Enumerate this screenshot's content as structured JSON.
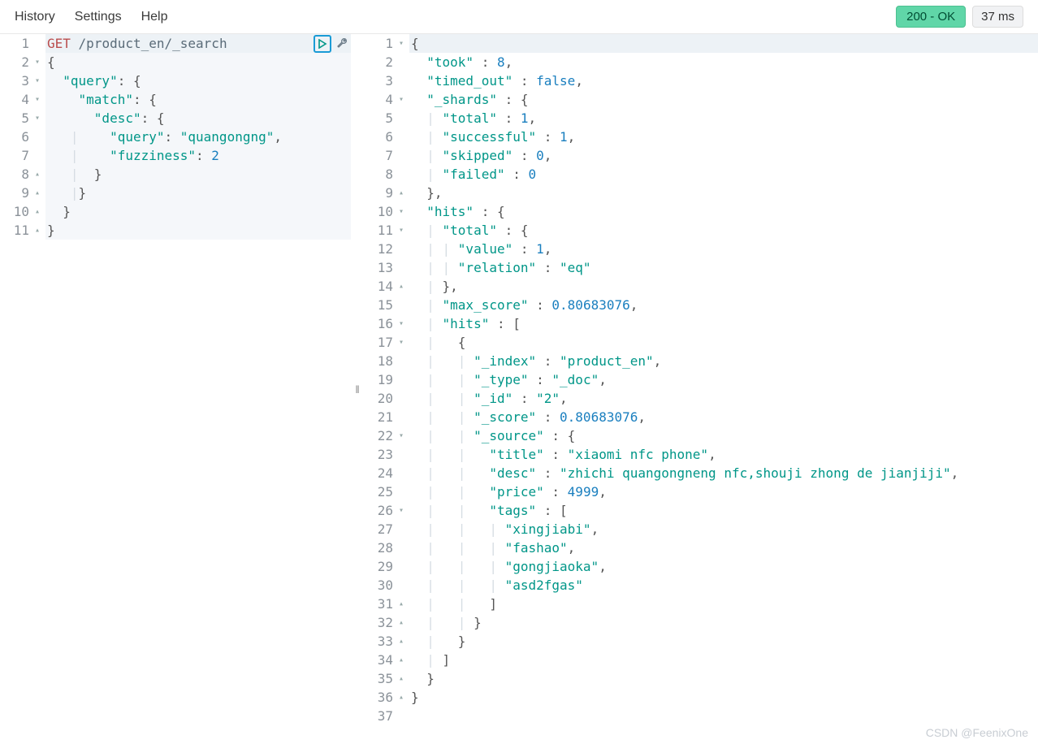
{
  "menu": {
    "history": "History",
    "settings": "Settings",
    "help": "Help"
  },
  "status": {
    "label": "200 - OK",
    "timing": "37 ms"
  },
  "request": {
    "lines": [
      {
        "n": 1,
        "fold": "",
        "hl": true,
        "tokens": [
          [
            "method",
            "GET"
          ],
          [
            "text",
            " "
          ],
          [
            "path",
            "/product_en/_search"
          ]
        ]
      },
      {
        "n": 2,
        "fold": "▾",
        "hl": false,
        "tokens": [
          [
            "brace",
            "{"
          ]
        ]
      },
      {
        "n": 3,
        "fold": "▾",
        "hl": false,
        "tokens": [
          [
            "text",
            "  "
          ],
          [
            "key",
            "\"query\""
          ],
          [
            "punc",
            ": "
          ],
          [
            "brace",
            "{"
          ]
        ]
      },
      {
        "n": 4,
        "fold": "▾",
        "hl": false,
        "tokens": [
          [
            "text",
            "    "
          ],
          [
            "key",
            "\"match\""
          ],
          [
            "punc",
            ": "
          ],
          [
            "brace",
            "{"
          ]
        ]
      },
      {
        "n": 5,
        "fold": "▾",
        "hl": false,
        "tokens": [
          [
            "text",
            "      "
          ],
          [
            "key",
            "\"desc\""
          ],
          [
            "punc",
            ": "
          ],
          [
            "brace",
            "{"
          ]
        ]
      },
      {
        "n": 6,
        "fold": "",
        "hl": false,
        "tokens": [
          [
            "guide",
            "   |    "
          ],
          [
            "key",
            "\"query\""
          ],
          [
            "punc",
            ": "
          ],
          [
            "str",
            "\"quangongng\""
          ],
          [
            "punc",
            ","
          ]
        ]
      },
      {
        "n": 7,
        "fold": "",
        "hl": false,
        "tokens": [
          [
            "guide",
            "   |    "
          ],
          [
            "key",
            "\"fuzziness\""
          ],
          [
            "punc",
            ": "
          ],
          [
            "num",
            "2"
          ]
        ]
      },
      {
        "n": 8,
        "fold": "▴",
        "hl": false,
        "tokens": [
          [
            "guide",
            "   |  "
          ],
          [
            "brace",
            "}"
          ]
        ]
      },
      {
        "n": 9,
        "fold": "▴",
        "hl": false,
        "tokens": [
          [
            "guide",
            "   |"
          ],
          [
            "brace",
            "}"
          ]
        ]
      },
      {
        "n": 10,
        "fold": "▴",
        "hl": false,
        "tokens": [
          [
            "text",
            "  "
          ],
          [
            "brace",
            "}"
          ]
        ]
      },
      {
        "n": 11,
        "fold": "▴",
        "hl": false,
        "tokens": [
          [
            "brace",
            "}"
          ]
        ]
      }
    ]
  },
  "response": {
    "lines": [
      {
        "n": 1,
        "fold": "▾",
        "hl": true,
        "tokens": [
          [
            "brace",
            "{"
          ]
        ]
      },
      {
        "n": 2,
        "fold": "",
        "tokens": [
          [
            "text",
            "  "
          ],
          [
            "key",
            "\"took\""
          ],
          [
            "punc",
            " : "
          ],
          [
            "num",
            "8"
          ],
          [
            "punc",
            ","
          ]
        ]
      },
      {
        "n": 3,
        "fold": "",
        "tokens": [
          [
            "text",
            "  "
          ],
          [
            "key",
            "\"timed_out\""
          ],
          [
            "punc",
            " : "
          ],
          [
            "bool",
            "false"
          ],
          [
            "punc",
            ","
          ]
        ]
      },
      {
        "n": 4,
        "fold": "▾",
        "tokens": [
          [
            "text",
            "  "
          ],
          [
            "key",
            "\"_shards\""
          ],
          [
            "punc",
            " : "
          ],
          [
            "brace",
            "{"
          ]
        ]
      },
      {
        "n": 5,
        "fold": "",
        "tokens": [
          [
            "guide",
            "  | "
          ],
          [
            "key",
            "\"total\""
          ],
          [
            "punc",
            " : "
          ],
          [
            "num",
            "1"
          ],
          [
            "punc",
            ","
          ]
        ]
      },
      {
        "n": 6,
        "fold": "",
        "tokens": [
          [
            "guide",
            "  | "
          ],
          [
            "key",
            "\"successful\""
          ],
          [
            "punc",
            " : "
          ],
          [
            "num",
            "1"
          ],
          [
            "punc",
            ","
          ]
        ]
      },
      {
        "n": 7,
        "fold": "",
        "tokens": [
          [
            "guide",
            "  | "
          ],
          [
            "key",
            "\"skipped\""
          ],
          [
            "punc",
            " : "
          ],
          [
            "num",
            "0"
          ],
          [
            "punc",
            ","
          ]
        ]
      },
      {
        "n": 8,
        "fold": "",
        "tokens": [
          [
            "guide",
            "  | "
          ],
          [
            "key",
            "\"failed\""
          ],
          [
            "punc",
            " : "
          ],
          [
            "num",
            "0"
          ]
        ]
      },
      {
        "n": 9,
        "fold": "▴",
        "tokens": [
          [
            "text",
            "  "
          ],
          [
            "brace",
            "}"
          ],
          [
            "punc",
            ","
          ]
        ]
      },
      {
        "n": 10,
        "fold": "▾",
        "tokens": [
          [
            "text",
            "  "
          ],
          [
            "key",
            "\"hits\""
          ],
          [
            "punc",
            " : "
          ],
          [
            "brace",
            "{"
          ]
        ]
      },
      {
        "n": 11,
        "fold": "▾",
        "tokens": [
          [
            "guide",
            "  | "
          ],
          [
            "key",
            "\"total\""
          ],
          [
            "punc",
            " : "
          ],
          [
            "brace",
            "{"
          ]
        ]
      },
      {
        "n": 12,
        "fold": "",
        "tokens": [
          [
            "guide",
            "  | | "
          ],
          [
            "key",
            "\"value\""
          ],
          [
            "punc",
            " : "
          ],
          [
            "num",
            "1"
          ],
          [
            "punc",
            ","
          ]
        ]
      },
      {
        "n": 13,
        "fold": "",
        "tokens": [
          [
            "guide",
            "  | | "
          ],
          [
            "key",
            "\"relation\""
          ],
          [
            "punc",
            " : "
          ],
          [
            "str",
            "\"eq\""
          ]
        ]
      },
      {
        "n": 14,
        "fold": "▴",
        "tokens": [
          [
            "guide",
            "  | "
          ],
          [
            "brace",
            "}"
          ],
          [
            "punc",
            ","
          ]
        ]
      },
      {
        "n": 15,
        "fold": "",
        "tokens": [
          [
            "guide",
            "  | "
          ],
          [
            "key",
            "\"max_score\""
          ],
          [
            "punc",
            " : "
          ],
          [
            "num",
            "0.80683076"
          ],
          [
            "punc",
            ","
          ]
        ]
      },
      {
        "n": 16,
        "fold": "▾",
        "tokens": [
          [
            "guide",
            "  | "
          ],
          [
            "key",
            "\"hits\""
          ],
          [
            "punc",
            " : "
          ],
          [
            "brace",
            "["
          ]
        ]
      },
      {
        "n": 17,
        "fold": "▾",
        "tokens": [
          [
            "guide",
            "  |   "
          ],
          [
            "brace",
            "{"
          ]
        ]
      },
      {
        "n": 18,
        "fold": "",
        "tokens": [
          [
            "guide",
            "  |   | "
          ],
          [
            "key",
            "\"_index\""
          ],
          [
            "punc",
            " : "
          ],
          [
            "str",
            "\"product_en\""
          ],
          [
            "punc",
            ","
          ]
        ]
      },
      {
        "n": 19,
        "fold": "",
        "tokens": [
          [
            "guide",
            "  |   | "
          ],
          [
            "key",
            "\"_type\""
          ],
          [
            "punc",
            " : "
          ],
          [
            "str",
            "\"_doc\""
          ],
          [
            "punc",
            ","
          ]
        ]
      },
      {
        "n": 20,
        "fold": "",
        "tokens": [
          [
            "guide",
            "  |   | "
          ],
          [
            "key",
            "\"_id\""
          ],
          [
            "punc",
            " : "
          ],
          [
            "str",
            "\"2\""
          ],
          [
            "punc",
            ","
          ]
        ]
      },
      {
        "n": 21,
        "fold": "",
        "tokens": [
          [
            "guide",
            "  |   | "
          ],
          [
            "key",
            "\"_score\""
          ],
          [
            "punc",
            " : "
          ],
          [
            "num",
            "0.80683076"
          ],
          [
            "punc",
            ","
          ]
        ]
      },
      {
        "n": 22,
        "fold": "▾",
        "tokens": [
          [
            "guide",
            "  |   | "
          ],
          [
            "key",
            "\"_source\""
          ],
          [
            "punc",
            " : "
          ],
          [
            "brace",
            "{"
          ]
        ]
      },
      {
        "n": 23,
        "fold": "",
        "tokens": [
          [
            "guide",
            "  |   |   "
          ],
          [
            "key",
            "\"title\""
          ],
          [
            "punc",
            " : "
          ],
          [
            "str",
            "\"xiaomi nfc phone\""
          ],
          [
            "punc",
            ","
          ]
        ]
      },
      {
        "n": 24,
        "fold": "",
        "tokens": [
          [
            "guide",
            "  |   |   "
          ],
          [
            "key",
            "\"desc\""
          ],
          [
            "punc",
            " : "
          ],
          [
            "str",
            "\"zhichi quangongneng nfc,shouji zhong de jianjiji\""
          ],
          [
            "punc",
            ","
          ]
        ]
      },
      {
        "n": 25,
        "fold": "",
        "tokens": [
          [
            "guide",
            "  |   |   "
          ],
          [
            "key",
            "\"price\""
          ],
          [
            "punc",
            " : "
          ],
          [
            "num",
            "4999"
          ],
          [
            "punc",
            ","
          ]
        ]
      },
      {
        "n": 26,
        "fold": "▾",
        "tokens": [
          [
            "guide",
            "  |   |   "
          ],
          [
            "key",
            "\"tags\""
          ],
          [
            "punc",
            " : "
          ],
          [
            "brace",
            "["
          ]
        ]
      },
      {
        "n": 27,
        "fold": "",
        "tokens": [
          [
            "guide",
            "  |   |   | "
          ],
          [
            "str",
            "\"xingjiabi\""
          ],
          [
            "punc",
            ","
          ]
        ]
      },
      {
        "n": 28,
        "fold": "",
        "tokens": [
          [
            "guide",
            "  |   |   | "
          ],
          [
            "str",
            "\"fashao\""
          ],
          [
            "punc",
            ","
          ]
        ]
      },
      {
        "n": 29,
        "fold": "",
        "tokens": [
          [
            "guide",
            "  |   |   | "
          ],
          [
            "str",
            "\"gongjiaoka\""
          ],
          [
            "punc",
            ","
          ]
        ]
      },
      {
        "n": 30,
        "fold": "",
        "tokens": [
          [
            "guide",
            "  |   |   | "
          ],
          [
            "str",
            "\"asd2fgas\""
          ]
        ]
      },
      {
        "n": 31,
        "fold": "▴",
        "tokens": [
          [
            "guide",
            "  |   |   "
          ],
          [
            "brace",
            "]"
          ]
        ]
      },
      {
        "n": 32,
        "fold": "▴",
        "tokens": [
          [
            "guide",
            "  |   | "
          ],
          [
            "brace",
            "}"
          ]
        ]
      },
      {
        "n": 33,
        "fold": "▴",
        "tokens": [
          [
            "guide",
            "  |   "
          ],
          [
            "brace",
            "}"
          ]
        ]
      },
      {
        "n": 34,
        "fold": "▴",
        "tokens": [
          [
            "guide",
            "  | "
          ],
          [
            "brace",
            "]"
          ]
        ]
      },
      {
        "n": 35,
        "fold": "▴",
        "tokens": [
          [
            "text",
            "  "
          ],
          [
            "brace",
            "}"
          ]
        ]
      },
      {
        "n": 36,
        "fold": "▴",
        "tokens": [
          [
            "brace",
            "}"
          ]
        ]
      },
      {
        "n": 37,
        "fold": "",
        "tokens": []
      }
    ]
  },
  "watermark": "CSDN @FeenixOne"
}
